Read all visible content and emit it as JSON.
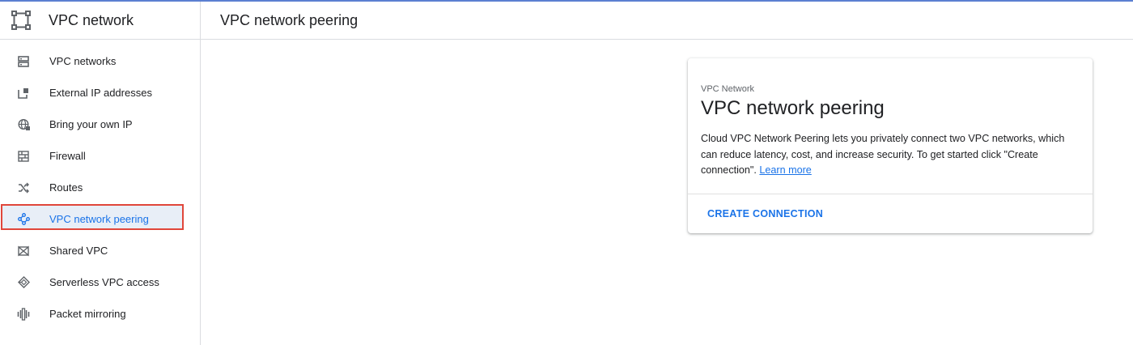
{
  "product": {
    "icon": "vpc-network-icon",
    "title": "VPC network"
  },
  "header": {
    "title": "VPC network peering"
  },
  "sidebar": {
    "items": [
      {
        "label": "VPC networks",
        "icon": "vpc-networks-icon",
        "active": false
      },
      {
        "label": "External IP addresses",
        "icon": "external-ip-icon",
        "active": false
      },
      {
        "label": "Bring your own IP",
        "icon": "globe-icon",
        "active": false
      },
      {
        "label": "Firewall",
        "icon": "firewall-icon",
        "active": false
      },
      {
        "label": "Routes",
        "icon": "routes-icon",
        "active": false
      },
      {
        "label": "VPC network peering",
        "icon": "peering-icon",
        "active": true
      },
      {
        "label": "Shared VPC",
        "icon": "shared-vpc-icon",
        "active": false
      },
      {
        "label": "Serverless VPC access",
        "icon": "serverless-icon",
        "active": false
      },
      {
        "label": "Packet mirroring",
        "icon": "packet-mirroring-icon",
        "active": false
      }
    ]
  },
  "card": {
    "eyebrow": "VPC Network",
    "title": "VPC network peering",
    "description": "Cloud VPC Network Peering lets you privately connect two VPC networks, which can reduce latency, cost, and increase security. To get started click \"Create connection\".",
    "learn_more": "Learn more",
    "action": "CREATE CONNECTION"
  },
  "colors": {
    "accent": "#1a73e8",
    "highlight_border": "#e0463a",
    "top_rule": "#5b7fd1"
  }
}
